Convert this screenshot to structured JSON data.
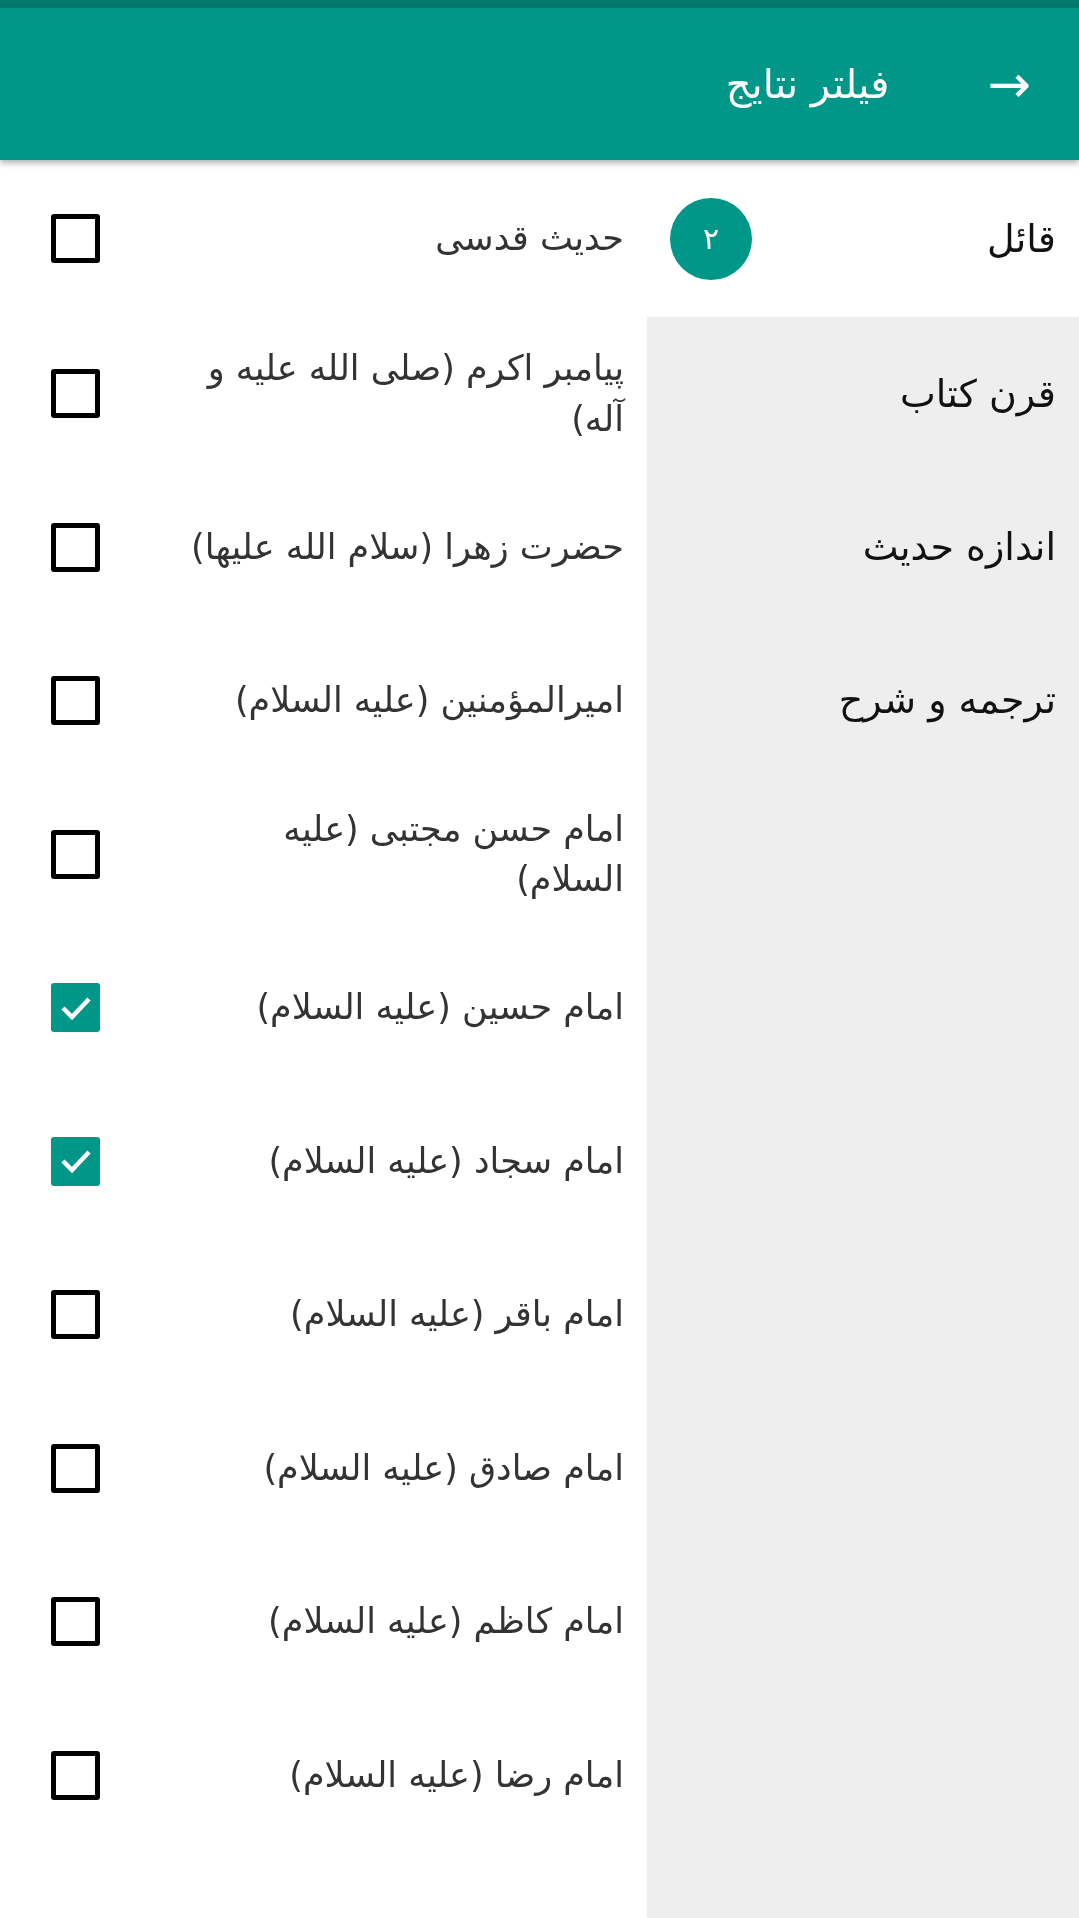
{
  "header": {
    "title": "فیلتر نتایج",
    "back_icon": "→"
  },
  "categories": [
    {
      "label": "قائل",
      "selected": true,
      "badge": "۲"
    },
    {
      "label": "قرن کتاب",
      "selected": false
    },
    {
      "label": "اندازه حدیث",
      "selected": false
    },
    {
      "label": "ترجمه و شرح",
      "selected": false
    }
  ],
  "options": [
    {
      "label": "حدیث قدسی",
      "checked": false
    },
    {
      "label": "پیامبر اکرم (صلی الله علیه و آله)",
      "checked": false
    },
    {
      "label": "حضرت زهرا (سلام الله علیها)",
      "checked": false
    },
    {
      "label": "امیرالمؤمنین (علیه السلام)",
      "checked": false
    },
    {
      "label": "امام حسن مجتبی (علیه السلام)",
      "checked": false
    },
    {
      "label": "امام حسین (علیه السلام)",
      "checked": true
    },
    {
      "label": "امام سجاد (علیه السلام)",
      "checked": true
    },
    {
      "label": "امام باقر (علیه السلام)",
      "checked": false
    },
    {
      "label": "امام صادق (علیه السلام)",
      "checked": false
    },
    {
      "label": "امام کاظم (علیه السلام)",
      "checked": false
    },
    {
      "label": "امام رضا (علیه السلام)",
      "checked": false
    }
  ]
}
